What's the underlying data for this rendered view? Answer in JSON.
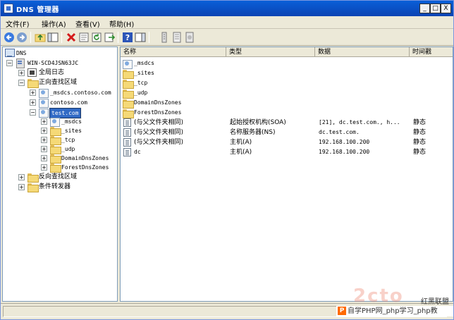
{
  "window": {
    "title": "DNS 管理器",
    "controls": {
      "minimize": "_",
      "restore": "□",
      "close": "X"
    }
  },
  "menu": {
    "items": [
      "文件(F)",
      "操作(A)",
      "查看(V)",
      "帮助(H)"
    ]
  },
  "toolbar": {
    "buttons": [
      "back-icon",
      "forward-icon",
      "up-icon",
      "show-hide-tree-icon",
      "delete-icon",
      "properties-icon",
      "refresh-icon",
      "export-icon",
      "help-icon",
      "action-pane-icon",
      "record-icon",
      "list-icon",
      "detail-icon"
    ]
  },
  "tree": {
    "root": "DNS",
    "server": "WIN-SCD4JSN63JC",
    "global_logs": "全局日志",
    "forward_zones": "正向查找区域",
    "zone_msdcs": "_msdcs.contoso.com",
    "zone_contoso": "contoso.com",
    "zone_test": "test.com",
    "sub_msdcs": "_msdcs",
    "sub_sites": "_sites",
    "sub_tcp": "_tcp",
    "sub_udp": "_udp",
    "sub_domain": "DomainDnsZones",
    "sub_forest": "ForestDnsZones",
    "reverse_zones": "反向查找区域",
    "conditional": "条件转发器"
  },
  "list": {
    "headers": {
      "name": "名称",
      "type": "类型",
      "data": "数据",
      "timestamp": "时间戳"
    },
    "folders": [
      "_msdcs",
      "_sites",
      "_tcp",
      "_udp",
      "DomainDnsZones",
      "ForestDnsZones"
    ],
    "records": [
      {
        "name": "(与父文件夹相同)",
        "type": "起始授权机构(SOA)",
        "data": "[21], dc.test.com., h...",
        "ts": "静态"
      },
      {
        "name": "(与父文件夹相同)",
        "type": "名称服务器(NS)",
        "data": "dc.test.com.",
        "ts": "静态"
      },
      {
        "name": "(与父文件夹相同)",
        "type": "主机(A)",
        "data": "192.168.100.200",
        "ts": "静态"
      },
      {
        "name": "dc",
        "type": "主机(A)",
        "data": "192.168.100.200",
        "ts": "静态"
      }
    ]
  },
  "watermark": {
    "side_text": "红黑联盟",
    "bar_icon": "P",
    "bar_text": "自学PHP网_php学习_php教"
  }
}
